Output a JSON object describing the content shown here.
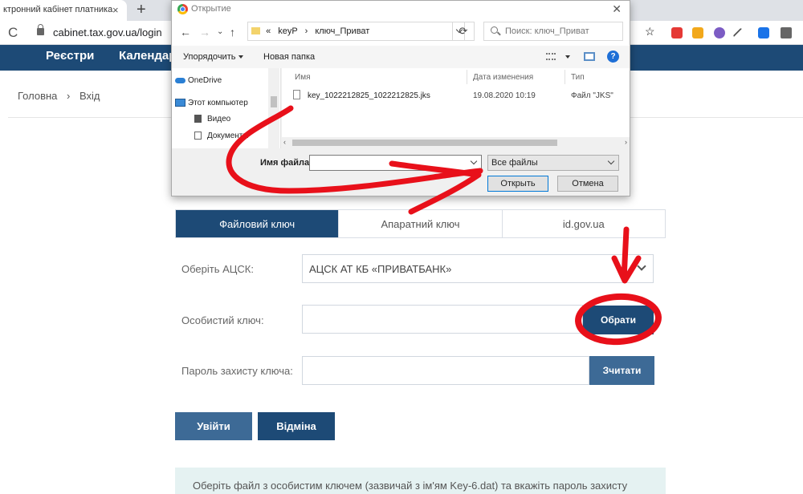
{
  "browser": {
    "tab_title": "ктронний кабінет платника",
    "tab_close": "×",
    "new_tab": "+",
    "reload": "C",
    "url": "cabinet.tax.gov.ua/login"
  },
  "site": {
    "nav": [
      "Реєстри",
      "Календар"
    ],
    "breadcrumb": {
      "home": "Головна",
      "separator": "›",
      "current": "Вхід"
    }
  },
  "login": {
    "tabs": [
      "Файловий ключ",
      "Апаратний ключ",
      "id.gov.ua"
    ],
    "acsk_label": "Оберіть АЦСК:",
    "acsk_value": "АЦСК АТ КБ «ПРИВАТБАНК»",
    "key_label": "Особистий ключ:",
    "key_value": "",
    "choose_button": "Обрати",
    "password_label": "Пароль захисту ключа:",
    "password_value": "",
    "read_button": "Зчитати",
    "login_button": "Увійти",
    "cancel_button": "Відміна",
    "info_text": "Оберіть файл з особистим ключем (зазвичай з ім'ям Key-6.dat) та вкажіть пароль захисту"
  },
  "dialog": {
    "title": "Открытие",
    "close": "✕",
    "path": [
      "«",
      "keyP",
      "›",
      "ключ_Приват"
    ],
    "search_placeholder": "Поиск: ключ_Приват",
    "toolbar": {
      "organize": "Упорядочить",
      "new_folder": "Новая папка",
      "help": "?"
    },
    "nav_items": [
      "OneDrive",
      "Этот компьютер",
      "Видео",
      "Документы"
    ],
    "columns": [
      "Имя",
      "Дата изменения",
      "Тип"
    ],
    "files": [
      {
        "name": "key_1022212825_1022212825.jks",
        "date": "19.08.2020 10:19",
        "type": "Файл \"JKS\""
      }
    ],
    "filename_label": "Имя файла:",
    "filename_value": "",
    "filetype": "Все файлы",
    "open_button": "Открыть",
    "cancel_button": "Отмена"
  },
  "colors": {
    "brand_navy": "#1d4a76",
    "button_blue": "#3d6a96",
    "annotation_red": "#e8101a",
    "info_bg": "#e5f2f2"
  },
  "icons": [
    "chrome-icon",
    "lock-icon",
    "reload-icon",
    "folder-icon",
    "file-icon",
    "search-icon",
    "help-icon",
    "cloud-icon",
    "computer-icon"
  ]
}
